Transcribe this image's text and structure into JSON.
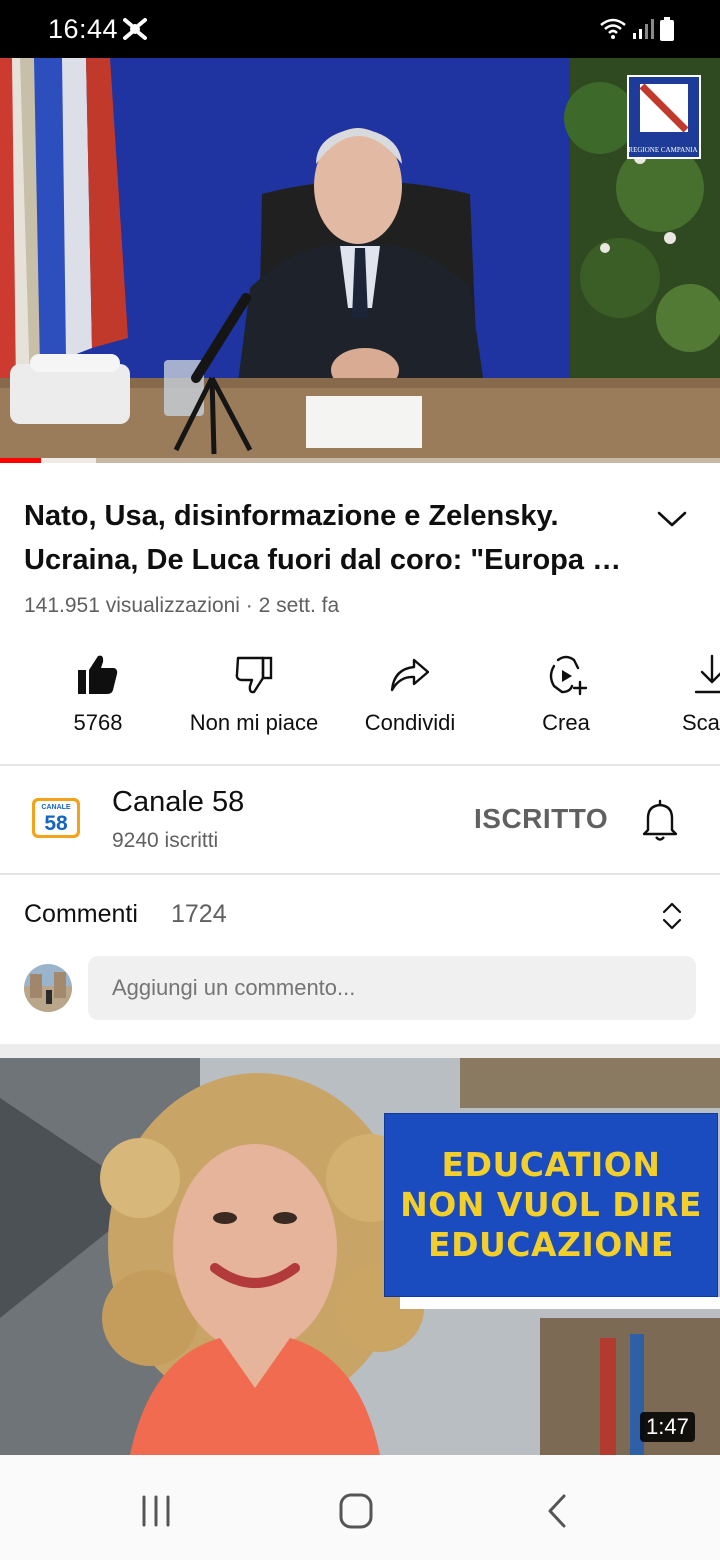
{
  "status_bar": {
    "time": "16:44",
    "app_icon": "notification-app-icon",
    "icons": [
      "wifi-icon",
      "signal-icon",
      "battery-icon"
    ]
  },
  "player": {
    "progress_fraction": 0.057,
    "buffer_fraction": 0.133,
    "watermark": "REGIONE CAMPANIA"
  },
  "video": {
    "title_line1": "Nato, Usa, disinformazione e Zelensky.",
    "title_line2": "Ucraina, De Luca fuori dal coro: \"Europa …",
    "meta": "141.951 visualizzazioni · 2 sett. fa"
  },
  "actions": {
    "like": {
      "label": "5768",
      "icon": "thumbs-up-filled-icon"
    },
    "dislike": {
      "label": "Non mi piace",
      "icon": "thumbs-down-icon"
    },
    "share": {
      "label": "Condividi",
      "icon": "share-arrow-icon"
    },
    "create": {
      "label": "Crea",
      "icon": "create-remix-icon"
    },
    "download": {
      "label": "Sca",
      "icon": "download-icon"
    }
  },
  "channel": {
    "name": "Canale 58",
    "subscribers": "9240 iscritti",
    "logo_text": "58",
    "logo_caption": "CANALE",
    "subscribe_state": "ISCRITTO",
    "accent": "#1565c0"
  },
  "comments": {
    "title": "Commenti",
    "count": "1724",
    "placeholder": "Aggiungi un commento..."
  },
  "next_video": {
    "banner_lines": [
      "EDUCATION",
      "NON VUOL DIRE",
      "EDUCAZIONE"
    ],
    "duration": "1:47"
  },
  "nav_bar": {
    "buttons": [
      "recent-apps-icon",
      "home-icon",
      "back-icon"
    ]
  }
}
